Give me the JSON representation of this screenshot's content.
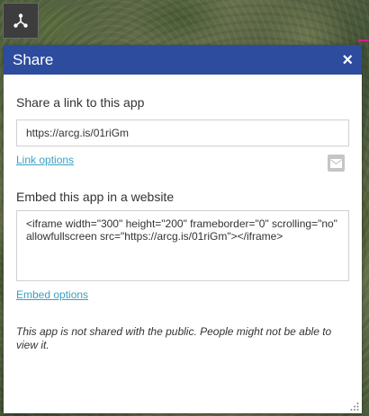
{
  "toggle": {
    "icon": "share-icon"
  },
  "panel": {
    "title": "Share",
    "close_icon": "close-icon",
    "close_label": "×",
    "link_section": {
      "heading": "Share a link to this app",
      "url": "https://arcg.is/01riGm",
      "options_label": "Link options",
      "email_icon": "email-icon"
    },
    "embed_section": {
      "heading": "Embed this app in a website",
      "code": "<iframe width=\"300\" height=\"200\" frameborder=\"0\" scrolling=\"no\" allowfullscreen src=\"https://arcg.is/01riGm\"></iframe>",
      "options_label": "Embed options"
    },
    "notice": "This app is not shared with the public. People might not be able to view it."
  },
  "colors": {
    "header_bg": "#2d4c9d",
    "link": "#3aa0c4"
  }
}
